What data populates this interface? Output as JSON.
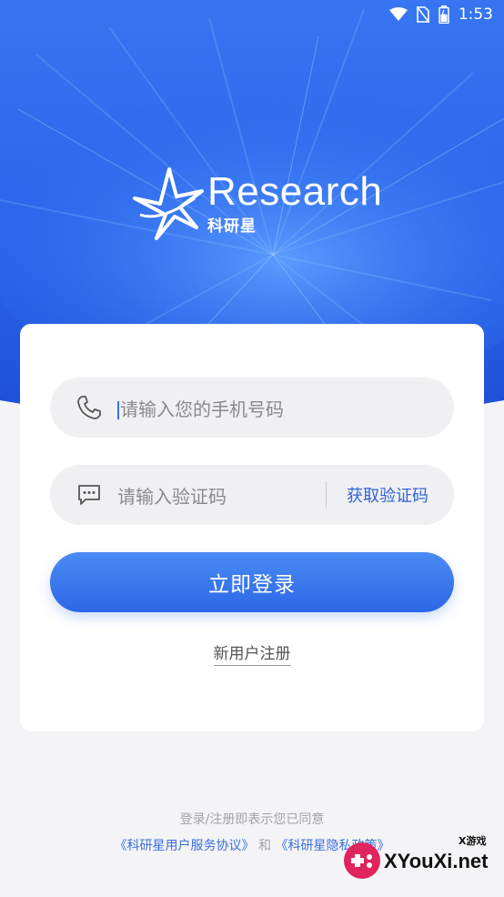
{
  "status": {
    "time": "1:53",
    "icons": [
      "wifi-icon",
      "no-sim-icon",
      "battery-icon"
    ]
  },
  "brand": {
    "wordmark": "Research",
    "name_cn": "科研星"
  },
  "form": {
    "phone_placeholder": "请输入您的手机号码",
    "code_placeholder": "请输入验证码",
    "get_code_label": "获取验证码",
    "login_label": "立即登录",
    "register_label": "新用户注册"
  },
  "agreement": {
    "prefix": "登录/注册即表示您已同意",
    "user_agreement": "《科研星用户服务协议》",
    "conjunction": "和",
    "privacy_policy": "《科研星隐私政策》"
  },
  "watermark": {
    "text": "XYouXi.net",
    "small": "X游戏"
  },
  "colors": {
    "accent": "#2f63d6",
    "hero_top": "#2f6ef0",
    "hero_bottom": "#1a4fd8",
    "field_bg": "#f0f0f2",
    "button_top": "#4b8bf3",
    "button_bottom": "#2b67e6"
  }
}
